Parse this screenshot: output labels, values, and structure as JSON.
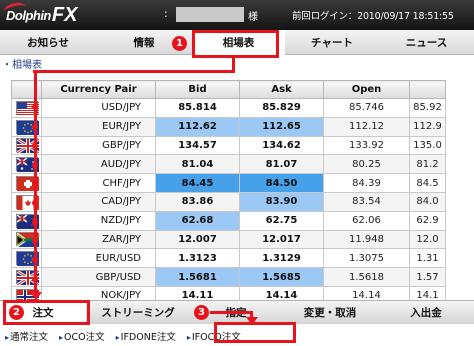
{
  "header": {
    "brand": "Dolphin",
    "brand_suffix": "FX",
    "user_colon": ":",
    "user_suffix": "様",
    "last_login": "前回ログイン：2010/09/17 18:51:55"
  },
  "main_nav": {
    "tabs": [
      {
        "label": "お知らせ"
      },
      {
        "label": "情報"
      },
      {
        "label": "相場表",
        "active": true
      },
      {
        "label": "チャート"
      },
      {
        "label": "ニュース"
      }
    ]
  },
  "breadcrumb": "・相場表",
  "rate_table": {
    "headers": [
      "",
      "Currency Pair",
      "Bid",
      "Ask",
      "Open",
      ""
    ],
    "rows": [
      {
        "flag": "us-flag",
        "pair": "USD/JPY",
        "bid": "85.814",
        "ask": "85.829",
        "open": "85.746",
        "extra": "85.92"
      },
      {
        "flag": "eu-flag",
        "pair": "EUR/JPY",
        "bid": "112.62",
        "ask": "112.65",
        "open": "112.12",
        "extra": "112.9",
        "bid_hl": "light",
        "ask_hl": "light"
      },
      {
        "flag": "gb-flag",
        "pair": "GBP/JPY",
        "bid": "134.57",
        "ask": "134.62",
        "open": "133.92",
        "extra": "135.0"
      },
      {
        "flag": "au-flag",
        "pair": "AUD/JPY",
        "bid": "81.04",
        "ask": "81.07",
        "open": "80.25",
        "extra": "81.2"
      },
      {
        "flag": "ch-flag",
        "pair": "CHF/JPY",
        "bid": "84.45",
        "ask": "84.50",
        "open": "84.39",
        "extra": "84.5",
        "bid_hl": "strong",
        "ask_hl": "strong"
      },
      {
        "flag": "ca-flag",
        "pair": "CAD/JPY",
        "bid": "83.86",
        "ask": "83.90",
        "open": "83.54",
        "extra": "84.0",
        "ask_hl": "light"
      },
      {
        "flag": "nz-flag",
        "pair": "NZD/JPY",
        "bid": "62.68",
        "ask": "62.75",
        "open": "62.06",
        "extra": "62.9",
        "bid_hl": "light"
      },
      {
        "flag": "za-flag",
        "pair": "ZAR/JPY",
        "bid": "12.007",
        "ask": "12.017",
        "open": "11.948",
        "extra": "12.0"
      },
      {
        "flag": "eu-flag",
        "pair": "EUR/USD",
        "bid": "1.3123",
        "ask": "1.3129",
        "open": "1.3075",
        "extra": "1.31"
      },
      {
        "flag": "gb-flag",
        "pair": "GBP/USD",
        "bid": "1.5681",
        "ask": "1.5685",
        "open": "1.5618",
        "extra": "1.57",
        "bid_hl": "light",
        "ask_hl": "light"
      },
      {
        "flag": "no-flag",
        "pair": "NOK/JPY",
        "bid": "14.11",
        "ask": "14.14",
        "open": "14.14",
        "extra": "14.1"
      }
    ]
  },
  "sub_nav": {
    "tabs": [
      {
        "label": "注文",
        "active": true
      },
      {
        "label": "ストリーミング"
      },
      {
        "label": "指定"
      },
      {
        "label": "変更・取消"
      },
      {
        "label": "入出金"
      }
    ]
  },
  "order_menu": {
    "items": [
      {
        "label": "通常注文"
      },
      {
        "label": "OCO注文"
      },
      {
        "label": "IFDONE注文"
      },
      {
        "label": "IFOCO注文",
        "active": true
      }
    ]
  },
  "annotations": {
    "step1": "1",
    "step2": "2",
    "step3": "3"
  },
  "colors": {
    "annotation_red": "#e8141b",
    "highlight_light": "#9cc8f5",
    "highlight_strong": "#46a0ea",
    "header_dark": "#1e1e1e"
  }
}
